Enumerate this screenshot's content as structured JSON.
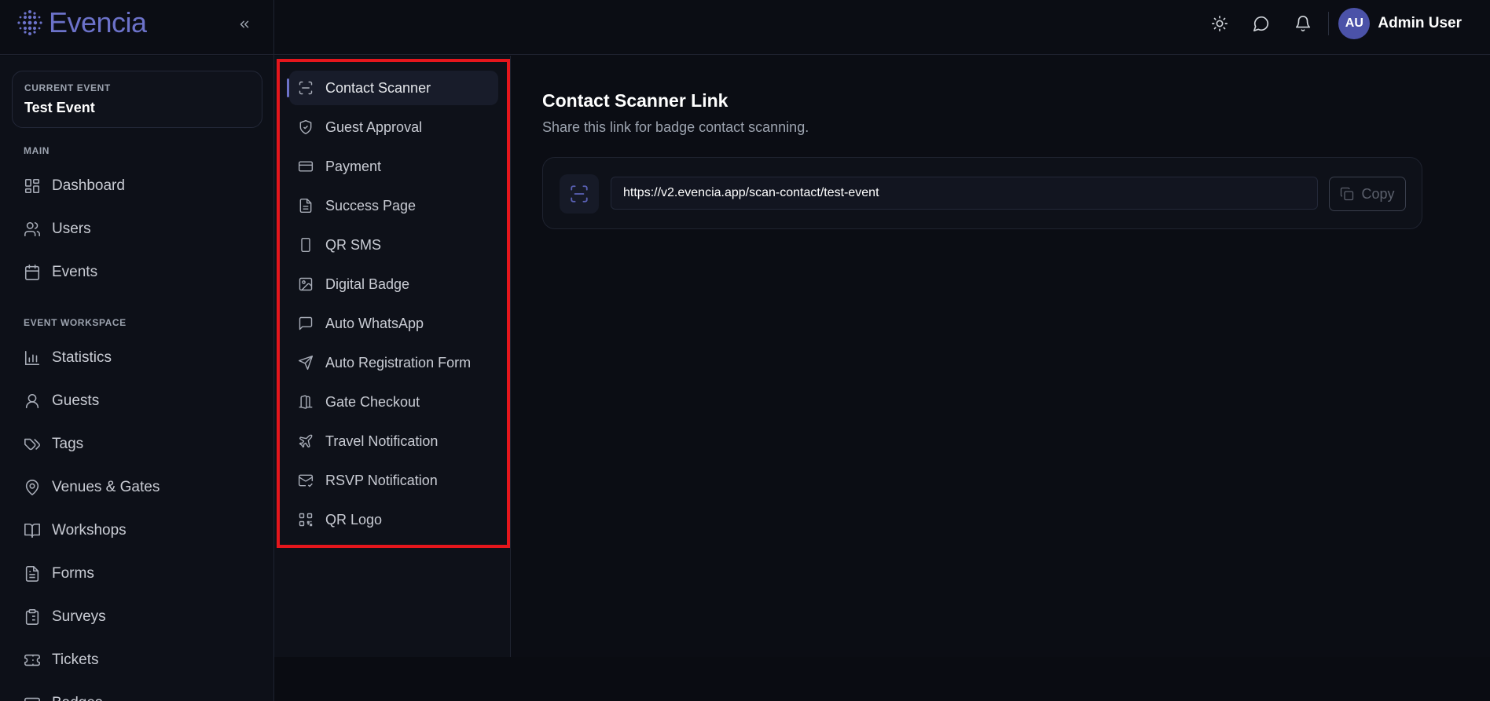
{
  "app": {
    "logo_text": "Evencia",
    "brand_color": "#6c72c9"
  },
  "header": {
    "icons": [
      "sun-icon",
      "message-icon",
      "bell-icon"
    ],
    "user": {
      "initials": "AU",
      "name": "Admin User"
    }
  },
  "sidebar": {
    "current_event_label": "CURRENT EVENT",
    "current_event_name": "Test Event",
    "main_label": "MAIN",
    "main_items": [
      {
        "label": "Dashboard",
        "icon": "dashboard-icon"
      },
      {
        "label": "Users",
        "icon": "users-icon"
      },
      {
        "label": "Events",
        "icon": "calendar-icon"
      }
    ],
    "workspace_label": "EVENT WORKSPACE",
    "workspace_items": [
      {
        "label": "Statistics",
        "icon": "bar-chart-icon"
      },
      {
        "label": "Guests",
        "icon": "user-icon"
      },
      {
        "label": "Tags",
        "icon": "tags-icon"
      },
      {
        "label": "Venues & Gates",
        "icon": "map-pin-icon"
      },
      {
        "label": "Workshops",
        "icon": "book-icon"
      },
      {
        "label": "Forms",
        "icon": "file-text-icon"
      },
      {
        "label": "Surveys",
        "icon": "clipboard-icon"
      },
      {
        "label": "Tickets",
        "icon": "ticket-icon"
      },
      {
        "label": "Badges",
        "icon": "badge-icon"
      }
    ]
  },
  "subnav": {
    "items": [
      {
        "label": "Contact Scanner",
        "icon": "scan-icon",
        "active": true
      },
      {
        "label": "Guest Approval",
        "icon": "shield-check-icon"
      },
      {
        "label": "Payment",
        "icon": "credit-card-icon"
      },
      {
        "label": "Success Page",
        "icon": "file-icon"
      },
      {
        "label": "QR SMS",
        "icon": "smartphone-icon"
      },
      {
        "label": "Digital Badge",
        "icon": "image-icon"
      },
      {
        "label": "Auto WhatsApp",
        "icon": "message-square-icon"
      },
      {
        "label": "Auto Registration Form",
        "icon": "send-icon"
      },
      {
        "label": "Gate Checkout",
        "icon": "door-icon"
      },
      {
        "label": "Travel Notification",
        "icon": "plane-icon"
      },
      {
        "label": "RSVP Notification",
        "icon": "mail-check-icon"
      },
      {
        "label": "QR Logo",
        "icon": "qr-code-icon"
      }
    ],
    "highlight_color": "#e5161c"
  },
  "main": {
    "title": "Contact Scanner Link",
    "subtitle": "Share this link for badge contact scanning.",
    "link_value": "https://v2.evencia.app/scan-contact/test-event",
    "copy_label": "Copy"
  }
}
